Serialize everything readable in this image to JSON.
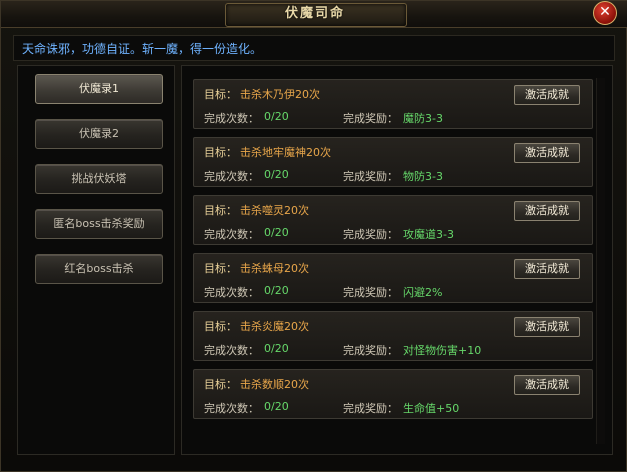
{
  "window": {
    "title": "伏魔司命",
    "close_label": "✕"
  },
  "subtitle": "天命诛邪，功德自证。斩一魔，得一份造化。",
  "sidebar": {
    "items": [
      {
        "label": "伏魔录1",
        "active": true
      },
      {
        "label": "伏魔录2",
        "active": false
      },
      {
        "label": "挑战伏妖塔",
        "active": false
      },
      {
        "label": "匿名boss击杀奖励",
        "active": false
      },
      {
        "label": "红名boss击杀",
        "active": false
      }
    ]
  },
  "quests": {
    "target_label": "目标：",
    "count_label": "完成次数：",
    "reward_label": "完成奖励：",
    "button_label": "激活成就",
    "items": [
      {
        "target": "击杀木乃伊20次",
        "count": "0/20",
        "reward": "魔防3-3"
      },
      {
        "target": "击杀地牢魔神20次",
        "count": "0/20",
        "reward": "物防3-3"
      },
      {
        "target": "击杀噬灵20次",
        "count": "0/20",
        "reward": "攻魔道3-3"
      },
      {
        "target": "击杀蛛母20次",
        "count": "0/20",
        "reward": "闪避2%"
      },
      {
        "target": "击杀炎魔20次",
        "count": "0/20",
        "reward": "对怪物伤害+10"
      },
      {
        "target": "击杀数顺20次",
        "count": "0/20",
        "reward": "生命值+50"
      }
    ]
  },
  "colors": {
    "target_text": "#e8a64a",
    "value_text": "#66d86a",
    "subtitle_text": "#6fb3ff"
  }
}
